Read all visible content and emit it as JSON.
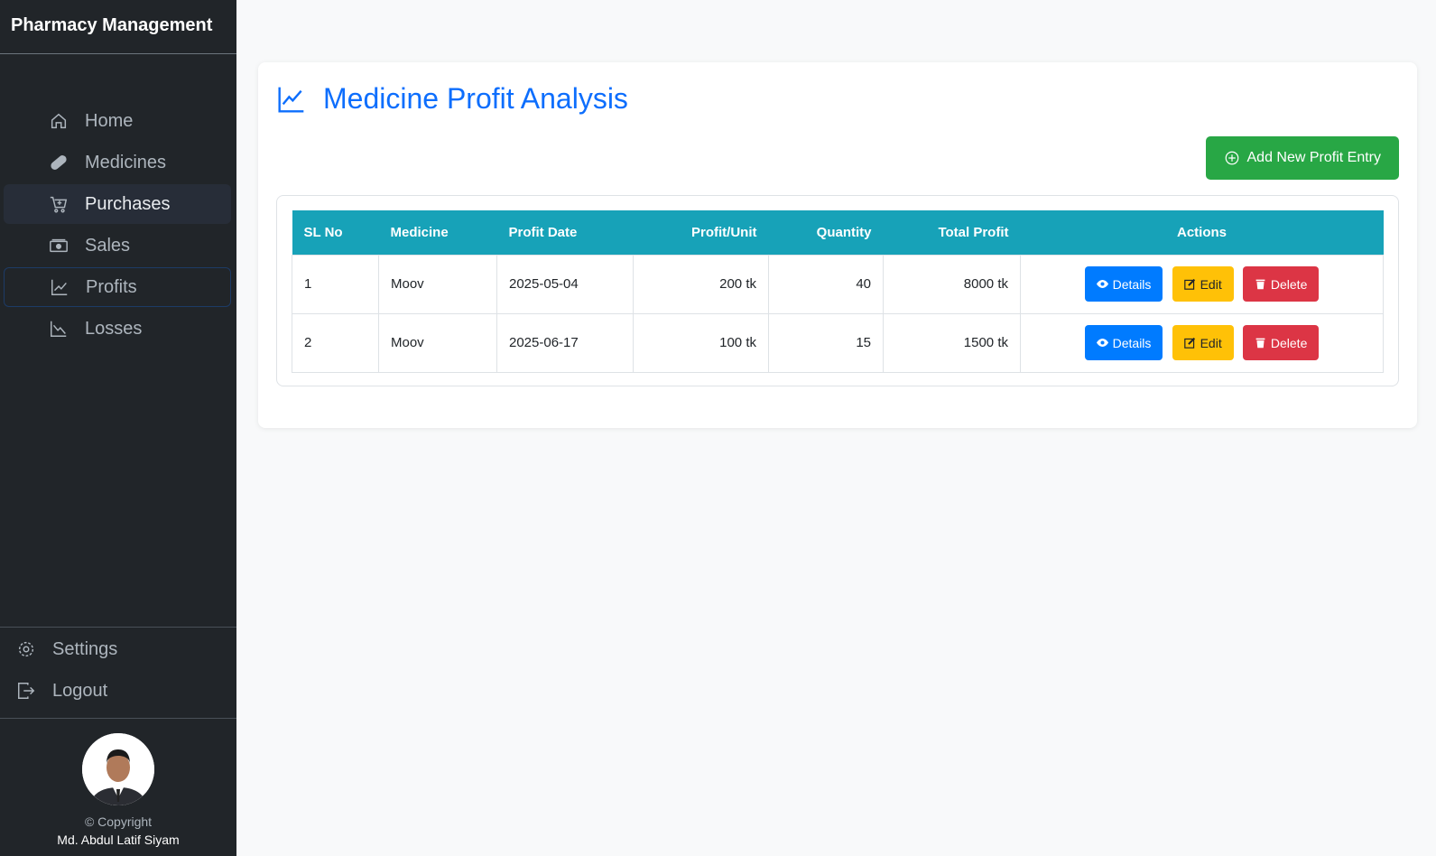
{
  "sidebar": {
    "brand": "Pharmacy Management",
    "items": [
      {
        "label": "Home",
        "icon": "home-icon"
      },
      {
        "label": "Medicines",
        "icon": "capsule-icon"
      },
      {
        "label": "Purchases",
        "icon": "cart-plus-icon"
      },
      {
        "label": "Sales",
        "icon": "cash-icon"
      },
      {
        "label": "Profits",
        "icon": "graph-up-icon"
      },
      {
        "label": "Losses",
        "icon": "graph-down-icon"
      }
    ],
    "bottom": [
      {
        "label": "Settings",
        "icon": "gear-icon"
      },
      {
        "label": "Logout",
        "icon": "logout-icon"
      }
    ],
    "copyright": "© Copyright",
    "author": "Md. Abdul Latif Siyam"
  },
  "main": {
    "title": "Medicine Profit Analysis",
    "add_label": "Add New Profit Entry",
    "columns": [
      "SL No",
      "Medicine",
      "Profit Date",
      "Profit/Unit",
      "Quantity",
      "Total Profit",
      "Actions"
    ],
    "rows": [
      [
        "1",
        "Moov",
        "2025-05-04",
        "200 tk",
        "40",
        "8000 tk"
      ],
      [
        "2",
        "Moov",
        "2025-06-17",
        "100 tk",
        "15",
        "1500 tk"
      ]
    ],
    "actions": {
      "details": "Details",
      "edit": "Edit",
      "delete": "Delete"
    }
  },
  "colors": {
    "accent": "#0d6efd",
    "header": "#17a2b8",
    "add": "#28a745",
    "details": "#007bff",
    "edit": "#ffc107",
    "delete": "#dc3545"
  }
}
